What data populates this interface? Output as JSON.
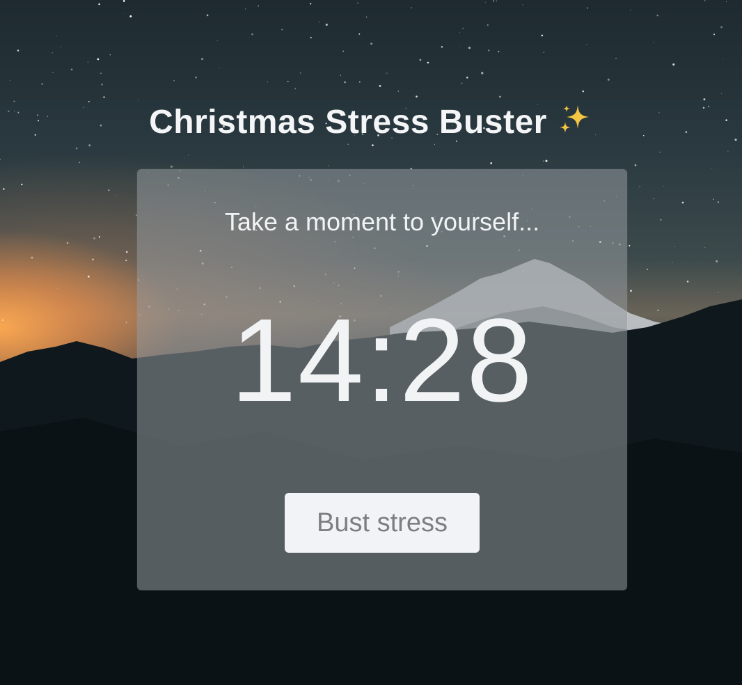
{
  "header": {
    "title": "Christmas Stress Buster",
    "title_icon": "sparkles-icon"
  },
  "card": {
    "subtitle": "Take a moment to yourself...",
    "timer": "14:28",
    "button_label": "Bust stress"
  },
  "colors": {
    "text": "#f2f3f5",
    "button_bg": "#f1f3f6",
    "button_text": "#7c7f82",
    "sparkle": "#f4c542",
    "sunset_glow": "#ffaa50"
  }
}
